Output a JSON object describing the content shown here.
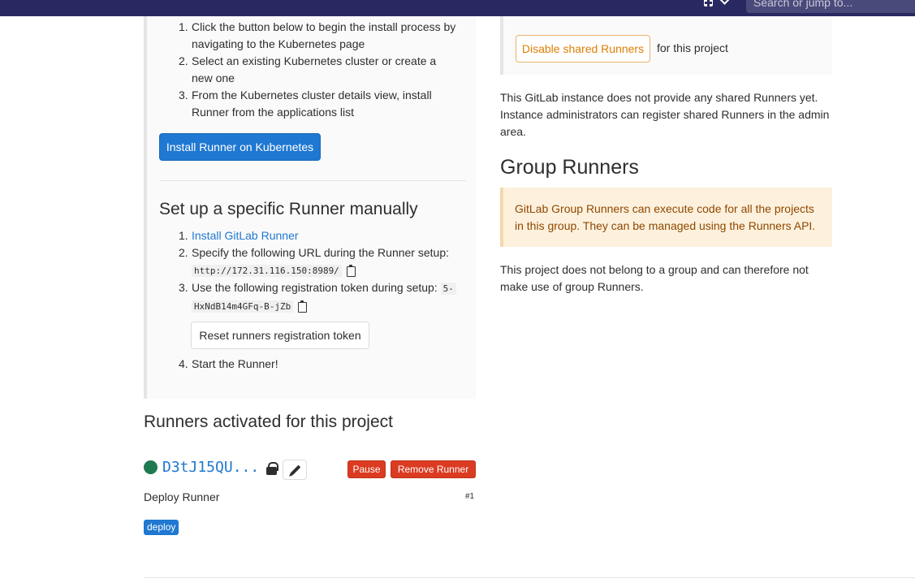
{
  "header": {
    "search_placeholder": "Search or jump to...",
    "icons": [
      "plus-square-icon",
      "chevron-down-icon"
    ]
  },
  "kubernetes": {
    "steps": [
      {
        "num": "1.",
        "text": "Click the button below to begin the install process by navigating to the Kubernetes page"
      },
      {
        "num": "2.",
        "text": "Select an existing Kubernetes cluster or create a new one"
      },
      {
        "num": "3.",
        "text": "From the Kubernetes cluster details view, install Runner from the applications list"
      }
    ],
    "install_button": "Install Runner on Kubernetes"
  },
  "manual": {
    "title": "Set up a specific Runner manually",
    "step1_num": "1.",
    "step1_link": "Install GitLab Runner",
    "step2_num": "2.",
    "step2_text": "Specify the following URL during the Runner setup:",
    "url": "http://172.31.116.150:8989/",
    "step3_num": "3.",
    "step3_text": "Use the following registration token during setup:",
    "token_part1": "5-",
    "token_part2": "HxNdB14m4GFq-B-jZb",
    "reset_button": "Reset runners registration token",
    "step4_num": "4.",
    "step4_text": "Start the Runner!"
  },
  "activated": {
    "title": "Runners activated for this project",
    "runner_id": "D3tJ15QU...",
    "pause_button": "Pause",
    "remove_button": "Remove Runner",
    "description": "Deploy Runner",
    "number": "#1",
    "tag": "deploy",
    "status_color": "#1f7a50",
    "icons": [
      "lock-icon",
      "pencil-icon"
    ]
  },
  "shared": {
    "disable_button": "Disable shared Runners",
    "for_project": "for this project",
    "info": "This GitLab instance does not provide any shared Runners yet. Instance administrators can register shared Runners in the admin area."
  },
  "group": {
    "title": "Group Runners",
    "alert": "GitLab Group Runners can execute code for all the projects in this group. They can be managed using the Runners API.",
    "note": "This project does not belong to a group and can therefore not make use of group Runners."
  },
  "colors": {
    "accent": "#1f78d1",
    "danger": "#db3b21",
    "warning": "#de7e00",
    "topbar": "#292961"
  }
}
